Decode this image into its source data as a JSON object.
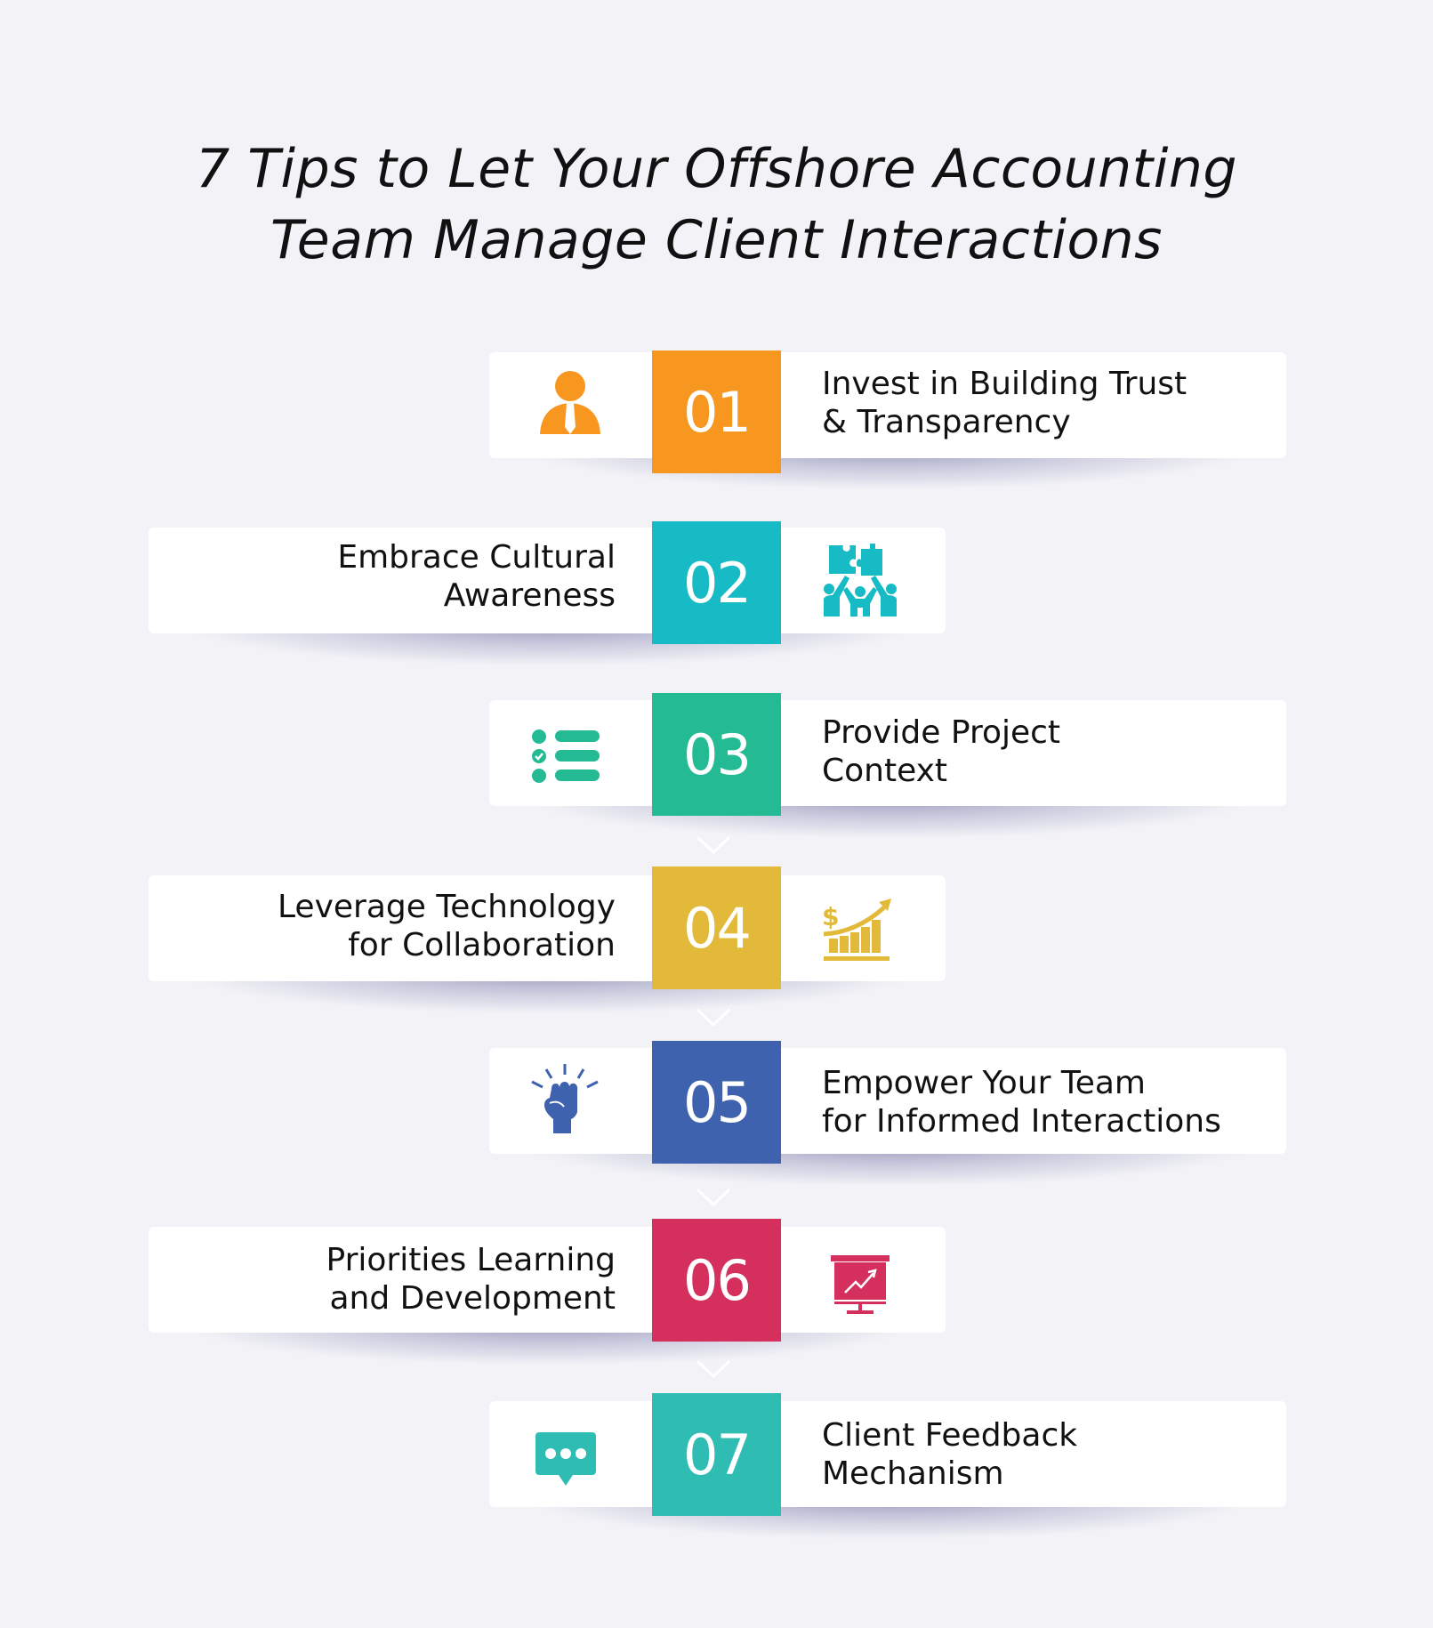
{
  "title": {
    "line1": "7 Tips to Let Your Offshore Accounting",
    "line2": "Team Manage Client Interactions"
  },
  "steps": [
    {
      "number": "01",
      "line1": "Invest in Building Trust",
      "line2": "& Transparency",
      "color": "#f7971f",
      "icon": "person-tie-icon",
      "side": "right"
    },
    {
      "number": "02",
      "line1": "Embrace Cultural",
      "line2": "Awareness",
      "color": "#17bbc6",
      "icon": "team-puzzle-icon",
      "side": "left"
    },
    {
      "number": "03",
      "line1": "Provide Project",
      "line2": "Context",
      "color": "#23ba94",
      "icon": "checklist-icon",
      "side": "right"
    },
    {
      "number": "04",
      "line1": "Leverage Technology",
      "line2": "for Collaboration",
      "color": "#e3b93a",
      "icon": "growth-chart-dollar-icon",
      "side": "left"
    },
    {
      "number": "05",
      "line1": "Empower Your Team",
      "line2": "for Informed Interactions",
      "color": "#3e62ad",
      "icon": "raised-fist-icon",
      "side": "right"
    },
    {
      "number": "06",
      "line1": "Priorities Learning",
      "line2": "and Development",
      "color": "#d52f5e",
      "icon": "presentation-board-icon",
      "side": "left"
    },
    {
      "number": "07",
      "line1": "Client Feedback",
      "line2": "Mechanism",
      "color": "#2fbdb3",
      "icon": "chat-bubble-icon",
      "side": "right"
    }
  ],
  "connectors": [
    "chevron-down-icon",
    "chevron-down-icon",
    "chevron-down-icon",
    "chevron-down-icon"
  ]
}
